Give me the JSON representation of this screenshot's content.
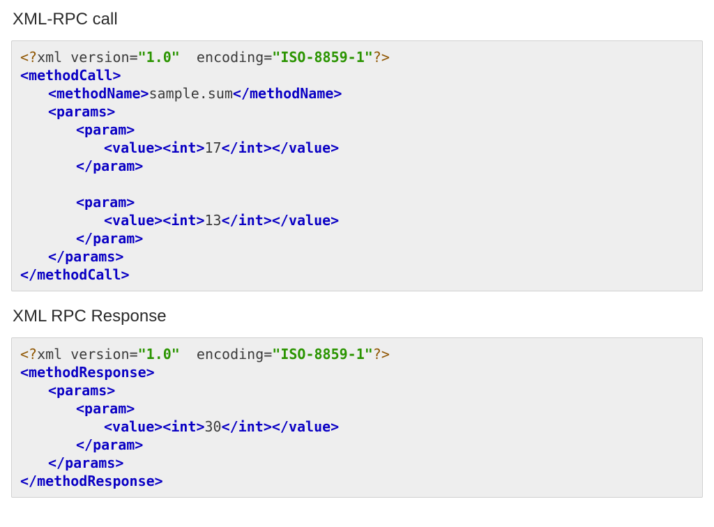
{
  "headings": {
    "call": "XML-RPC call",
    "response": "XML RPC Response"
  },
  "call": {
    "prolog": {
      "open": "<?",
      "xml": "xml",
      "sp": " ",
      "versionKey": "version",
      "eq": "=",
      "versionVal": "\"1.0\"",
      "encodingKey": "encoding",
      "encodingVal": "\"ISO-8859-1\"",
      "close": "?>"
    },
    "lines": {
      "methodCallOpen": "<methodCall>",
      "methodNameOpen": "<methodName>",
      "methodNameText": "sample.sum",
      "methodNameClose": "</methodName>",
      "paramsOpen": "<params>",
      "paramOpen": "<param>",
      "valueOpen": "<value>",
      "intOpen": "<int>",
      "v1": "17",
      "v2": "13",
      "intClose": "</int>",
      "valueClose": "</value>",
      "paramClose": "</param>",
      "paramsClose": "</params>",
      "methodCallClose": "</methodCall>"
    }
  },
  "response": {
    "prolog": {
      "open": "<?",
      "xml": "xml",
      "sp": " ",
      "versionKey": "version",
      "eq": "=",
      "versionVal": "\"1.0\"",
      "encodingKey": "encoding",
      "encodingVal": "\"ISO-8859-1\"",
      "close": "?>"
    },
    "lines": {
      "methodResponseOpen": "<methodResponse>",
      "paramsOpen": "<params>",
      "paramOpen": "<param>",
      "valueOpen": "<value>",
      "intOpen": "<int>",
      "v": "30",
      "intClose": "</int>",
      "valueClose": "</value>",
      "paramClose": "</param>",
      "paramsClose": "</params>",
      "methodResponseClose": "</methodResponse>"
    }
  }
}
